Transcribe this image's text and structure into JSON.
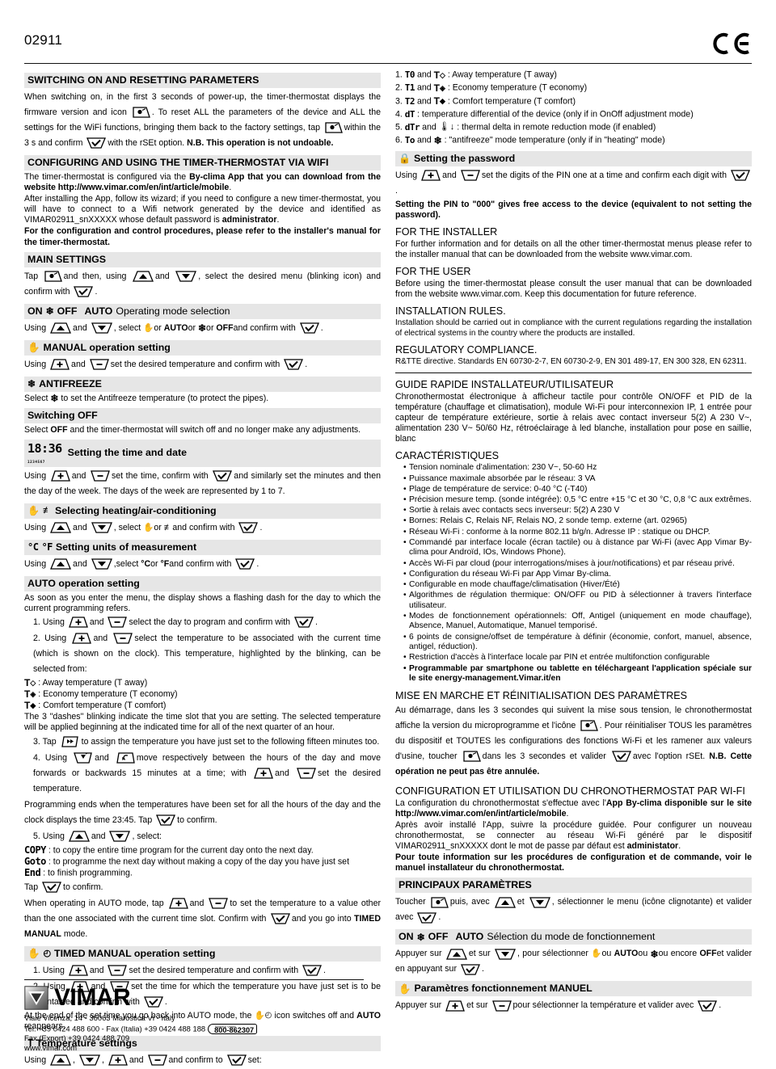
{
  "header": {
    "code": "02911",
    "ce_mark": "CE"
  },
  "left": {
    "s1_title": "SWITCHING ON AND RESETTING PARAMETERS",
    "s1_p1a": "When switching on, in the first 3 seconds of power-up, the timer-thermostat displays the firmware version and icon",
    "s1_p1b": ". To reset ALL the parameters of the device and ALL the settings for the WiFi functions, bringing them back to the factory settings, tap",
    "s1_p1c": "within the 3 s and confirm",
    "s1_p1d": "with the rSEt option.",
    "s1_p1e": "N.B. This operation is not undoable.",
    "s2_title": "CONFIGURING AND USING THE TIMER-THERMOSTAT VIA WIFI",
    "s2_p1a": "The timer-thermostat is configured via the",
    "s2_p1b": "By-clima App that you can download from the website http://www.vimar.com/en/int/article/mobile",
    "s2_p1c": ".",
    "s2_p2": "After installing the App, follow its wizard; if you need to configure a new timer-thermostat, you will have to connect to a Wifi network generated by the device and identified as VIMAR02911_snXXXXX whose default password is",
    "s2_p2b": "administrator",
    "s2_p2c": ".",
    "s2_p3": "For the configuration and control procedures, please refer to the installer's manual for the timer-thermostat.",
    "s3_title": "MAIN SETTINGS",
    "s3_p1a": "Tap",
    "s3_p1b": "and then, using",
    "s3_p1c": "and",
    "s3_p1d": ", select the desired menu (blinking icon) and confirm with",
    "s3_p1e": ".",
    "s4_title_on": "ON",
    "s4_title_off": "OFF",
    "s4_title_auto": "AUTO",
    "s4_title_rest": "Operating mode selection",
    "s4_p1a": "Using",
    "s4_p1b": "and",
    "s4_p1c": ", select",
    "s4_p1d": "or",
    "s4_p1e": "AUTO",
    "s4_p1f": "or",
    "s4_p1g": "or",
    "s4_p1h": "OFF",
    "s4_p1i": "and confirm with",
    "s4_p1j": ".",
    "s5_title": "MANUAL operation setting",
    "s5_p1a": "Using",
    "s5_p1b": "and",
    "s5_p1c": "set the desired temperature and confirm with",
    "s5_p1d": ".",
    "s6_title": "ANTIFREEZE",
    "s6_p1a": "Select",
    "s6_p1b": "to set the Antifreeze temperature (to protect the pipes).",
    "s7_title": "Switching OFF",
    "s7_p1a": "Select",
    "s7_p1b": "OFF",
    "s7_p1c": "and the timer-thermostat will switch off and no longer make any adjustments.",
    "s8_clock": "18:36",
    "s8_days": "1234567",
    "s8_title": "Setting the time and date",
    "s8_p1a": "Using",
    "s8_p1b": "and",
    "s8_p1c": "set the time, confirm with",
    "s8_p1d": "and similarly set the minutes and then the day of the week. The days of the week are represented by 1 to 7.",
    "s9_title": "Selecting heating/air-conditioning",
    "s9_p1a": "Using",
    "s9_p1b": "and",
    "s9_p1c": ", select",
    "s9_p1d": "or",
    "s9_p1e": "and confirm with",
    "s9_p1f": ".",
    "s10_c": "°C",
    "s10_f": "°F",
    "s10_title": "Setting units of measurement",
    "s10_p1a": "Using",
    "s10_p1b": "and",
    "s10_p1c": ",select",
    "s10_p1d": "°C",
    "s10_p1e": "or",
    "s10_p1f": "°F",
    "s10_p1g": "and confirm with",
    "s10_p1h": ".",
    "s11_title": "AUTO operation setting",
    "s11_p1": "As soon as you enter the menu, the display shows a flashing dash for the day to which the current programming refers.",
    "s11_i1a": "1. Using",
    "s11_i1b": "and",
    "s11_i1c": "select the day to program and confirm with",
    "s11_i1d": ".",
    "s11_i2a": "2. Using",
    "s11_i2b": "and",
    "s11_i2c": "select the temperature to be associated with the current time (which is shown on the clock). This temperature, highlighted by the blinking, can be selected from:",
    "s11_away": ": Away temperature (T away)",
    "s11_eco": ": Economy temperature (T economy)",
    "s11_comf": ": Comfort temperature (T comfort)",
    "s11_p2": "The 3 \"dashes\" blinking indicate the time slot that you are setting. The selected temperature will be applied beginning at the indicated time for all of the next quarter of an hour.",
    "s11_i3a": "3. Tap",
    "s11_i3b": "to assign the temperature you have just set to the following fifteen minutes too.",
    "s11_i4a": "4. Using",
    "s11_i4b": "and",
    "s11_i4c": "move respectively between the hours of the day and move forwards or backwards 15 minutes at a time; with",
    "s11_i4d": "and",
    "s11_i4e": "set the desired temperature.",
    "s11_p3a": "Programming ends when the temperatures have been set for all the hours of the day and the clock displays the time 23:45. Tap",
    "s11_p3b": "to confirm.",
    "s11_i5a": "5. Using",
    "s11_i5b": "and",
    "s11_i5c": ", select:",
    "s11_copy": "COPY",
    "s11_copy_d": ": to copy the entire time program for the current day onto the next day.",
    "s11_goto": "Goto",
    "s11_goto_d": ": to programme the next day without making a copy of the day you have just set",
    "s11_end": "End",
    "s11_end_d": ": to finish programming.",
    "s11_tapa": "Tap",
    "s11_tapb": "to confirm.",
    "s11_p4a": "When operating in AUTO mode, tap",
    "s11_p4b": "and",
    "s11_p4c": "to set the temperature to a value other than the one associated with the current time slot. Confirm with",
    "s11_p4d": "and you go into",
    "s11_p4e": "TIMED MANUAL",
    "s11_p4f": "mode.",
    "s12_title": "TIMED MANUAL operation setting",
    "s12_i1a": "1. Using",
    "s12_i1b": "and",
    "s12_i1c": "set the desired temperature and confirm with",
    "s12_i1d": ".",
    "s12_i2a": "2. Using",
    "s12_i2b": "and",
    "s12_i2c": "set the time for which the temperature you have just set is to be maintained and confirm with",
    "s12_i2d": ".",
    "s12_p1a": "At the end of the set time you go back into AUTO mode, the",
    "s12_p1b": "icon switches off and",
    "s12_p1c": "AUTO",
    "s12_p1d": "reappears.",
    "s13_title": "Temperature settings",
    "s13_p1a": "Using",
    "s13_p1b": ",",
    "s13_p1c": ",",
    "s13_p1d": "and",
    "s13_p1e": "and confirm to",
    "s13_p1f": "set:"
  },
  "right": {
    "params": [
      {
        "n": "1.",
        "code": "T0",
        "and": "and",
        "sym": "away",
        "desc": ": Away temperature (T away)"
      },
      {
        "n": "2.",
        "code": "T1",
        "and": "and",
        "sym": "eco",
        "desc": ": Economy temperature (T economy)"
      },
      {
        "n": "3.",
        "code": "T2",
        "and": "and",
        "sym": "comf",
        "desc": ": Comfort temperature (T comfort)"
      },
      {
        "n": "4.",
        "code": "dT",
        "and": "",
        "sym": "",
        "desc": ": temperature differential of the device (only if in OnOff adjustment mode)"
      },
      {
        "n": "5.",
        "code": "dTr",
        "and": "and",
        "sym": "thermo-down",
        "desc": ": thermal delta in remote reduction mode (if enabled)"
      },
      {
        "n": "6.",
        "code": "To",
        "and": "and",
        "sym": "snow",
        "desc": ": \"antifreeze\" mode temperature (only if in \"heating\" mode)"
      }
    ],
    "pw_title": "Setting the password",
    "pw_p1a": "Using",
    "pw_p1b": "and",
    "pw_p1c": "set the digits of the PIN one at a time and confirm each digit with",
    "pw_p1d": ".",
    "pw_p2": "Setting the PIN to \"000\" gives free access to the device (equivalent to not setting the password).",
    "installer_title": "FOR THE INSTALLER",
    "installer_p": "For further information and for details on all the other timer-thermostat menus please refer to the installer manual that can be downloaded from the website www.vimar.com.",
    "user_title": "FOR THE USER",
    "user_p": "Before using the timer-thermostat please consult the user manual that can be downloaded from the website www.vimar.com. Keep this documentation for future reference.",
    "rules_title": "INSTALLATION RULES.",
    "rules_p": "Installation should be carried out in compliance with the current regulations regarding the installation of electrical systems in the country where the products are installed.",
    "reg_title": "REGULATORY COMPLIANCE.",
    "reg_p": "R&TTE directive. Standards EN 60730-2-7, EN 60730-2-9, EN 301 489-17, EN 300 328, EN 62311.",
    "fr_guide_title": "GUIDE RAPIDE INSTALLATEUR/UTILISATEUR",
    "fr_intro": "Chronothermostat électronique à afficheur tactile pour contrôle ON/OFF et PID de la température (chauffage et climatisation), module Wi-Fi pour interconnexion IP, 1 entrée pour capteur de température extérieure, sortie à relais avec contact inverseur 5(2) A 230 V~, alimentation 230 V~ 50/60 Hz, rétroéclairage à led blanche, installation pour pose en saillie, blanc",
    "fr_carac_title": "CARACTÉRISTIQUES",
    "fr_bullets": [
      "Tension nominale d'alimentation: 230 V~, 50-60 Hz",
      "Puissance maximale absorbée par le réseau: 3 VA",
      "Plage de température de service: 0-40 °C (-T40)",
      "Précision mesure temp. (sonde intégrée): 0,5 °C entre +15 °C et 30 °C, 0,8 °C aux extrêmes.",
      "Sortie à relais avec contacts secs inverseur: 5(2) A 230 V",
      "Bornes: Relais C, Relais NF, Relais NO, 2 sonde temp. externe (art. 02965)",
      "Réseau Wi-Fi : conforme à la norme 802.11 b/g/n. Adresse IP : statique ou DHCP.",
      "Commandé par interface locale (écran tactile) ou à distance par Wi-Fi (avec App Vimar By-clima pour Androïd, IOs, Windows Phone).",
      "Accès Wi-Fi par cloud (pour interrogations/mises à jour/notifications) et par réseau privé.",
      "Configuration du réseau Wi-Fi par App Vimar By-clima.",
      "Configurable en mode chauffage/climatisation (Hiver/Été)",
      "Algorithmes de régulation thermique: ON/OFF ou PID à sélectionner à travers l'interface utilisateur.",
      "Modes de fonctionnement opérationnels: Off, Antigel (uniquement en mode chauffage), Absence, Manuel, Automatique, Manuel temporisé.",
      "6 points de consigne/offset de température à définir (économie, confort, manuel, absence, antigel, réduction).",
      "Restriction d'accès à l'interface locale par PIN et entrée multifonction configurable"
    ],
    "fr_bullet_bold": "Programmable par smartphone ou tablette en téléchargeant l'application spéciale sur le site energy-management.Vimar.it/en",
    "fr_s1_title": "MISE EN MARCHE ET RÉINITIALISATION DES PARAMÈTRES",
    "fr_s1_a": "Au démarrage, dans les 3 secondes qui suivent la mise sous tension, le chronothermostat affiche la version du microprogramme et l'icône",
    "fr_s1_b": ". Pour réinitialiser TOUS les paramètres du dispositif et TOUTES les configurations des fonctions Wi-Fi et les ramener aux valeurs d'usine, toucher",
    "fr_s1_c": "dans les 3 secondes et valider",
    "fr_s1_d": "avec l'option rSEt.",
    "fr_s1_e": "N.B. Cette opération ne peut pas être annulée.",
    "fr_s2_title": "CONFIGURATION ET UTILISATION DU CHRONOTHERMOSTAT PAR WI-FI",
    "fr_s2_a": "La configuration du chronothermostat s'effectue avec l'",
    "fr_s2_b": "App By-clima disponible sur le site http://www.vimar.com/en/int/article/mobile",
    "fr_s2_c": ".",
    "fr_s2_d": "Après avoir installé l'App, suivre la procédure guidée. Pour configurer un nouveau chronothermostat, se connecter au réseau Wi-Fi généré par le dispositif  VIMAR02911_snXXXXX dont le mot de passe par défaut est",
    "fr_s2_e": "administator",
    "fr_s2_f": ".",
    "fr_s2_g": "Pour toute information sur les procédures de configuration et de commande, voir le manuel installateur du chronothermostat.",
    "fr_s3_title": "PRINCIPAUX PARAMÈTRES",
    "fr_s3_a": "Toucher",
    "fr_s3_b": "puis, avec",
    "fr_s3_c": "et",
    "fr_s3_d": ", sélectionner le menu (icône clignotante) et valider avec",
    "fr_s3_e": ".",
    "fr_s4_on": "ON",
    "fr_s4_off": "OFF",
    "fr_s4_auto": "AUTO",
    "fr_s4_rest": "Sélection du mode de fonctionnement",
    "fr_s4_a": "Appuyer sur",
    "fr_s4_b": "et sur",
    "fr_s4_c": ", pour sélectionner",
    "fr_s4_d": "ou",
    "fr_s4_e": "AUTO",
    "fr_s4_f": "ou",
    "fr_s4_g": "ou encore",
    "fr_s4_h": "OFF",
    "fr_s4_i": "et valider en appuyant sur",
    "fr_s4_j": ".",
    "fr_s5_title": "Paramètres fonctionnement MANUEL",
    "fr_s5_a": "Appuyer sur",
    "fr_s5_b": "et sur",
    "fr_s5_c": "pour sélectionner la température et valider avec",
    "fr_s5_d": "."
  },
  "footer": {
    "brand": "VIMAR",
    "address": "Viale Vicenza, 14 - 36063 Marostica VI - Italy",
    "tel": "Tel. +39 0424 488 600 - Fax (Italia) +39 0424 488 188",
    "badge_top": "Numero Verde",
    "badge_num": "800-862307",
    "fax_export": "Fax (Export) +39 0424 488 709",
    "web": "www.vimar.com"
  }
}
